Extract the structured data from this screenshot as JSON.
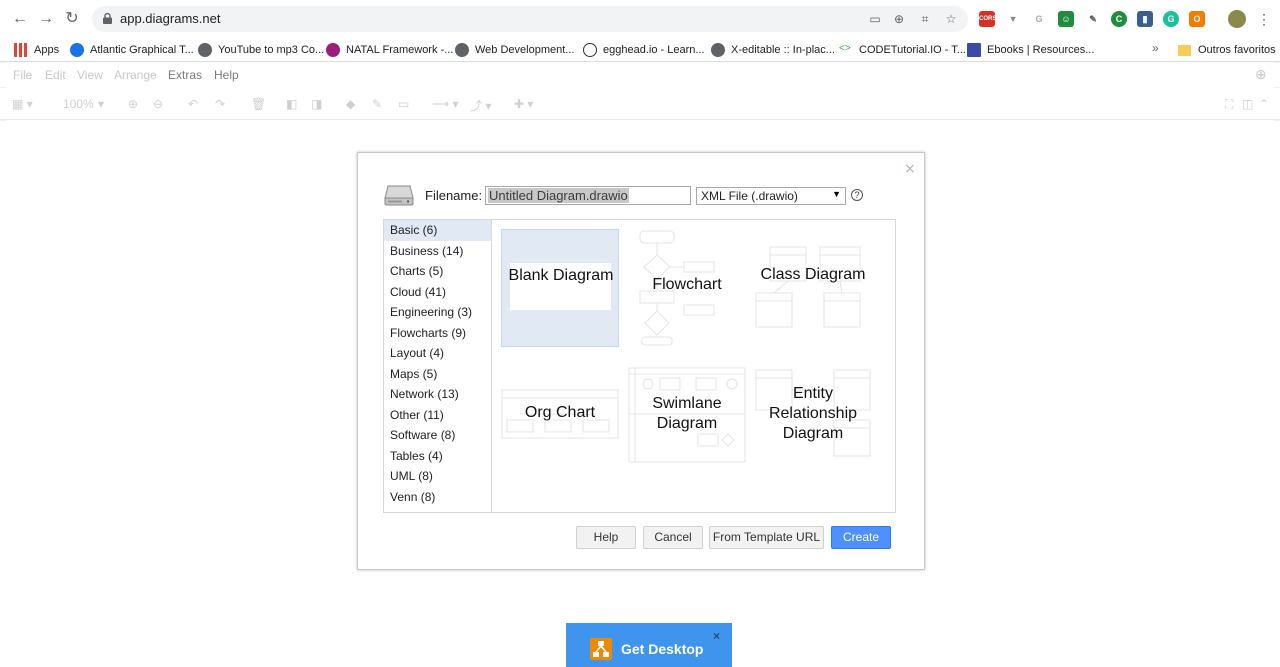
{
  "browser": {
    "url": "app.diagrams.net",
    "bookmarks": [
      {
        "label": "Apps",
        "color": "#e94235"
      },
      {
        "label": "Atlantic Graphical T...",
        "color": "#1a73e8"
      },
      {
        "label": "YouTube to mp3 Co...",
        "color": "#5f6368"
      },
      {
        "label": "NATAL Framework -...",
        "color": "#9c1d7a"
      },
      {
        "label": "Web Development...",
        "color": "#5f6368"
      },
      {
        "label": "egghead.io - Learn...",
        "color": "#333333"
      },
      {
        "label": "X-editable :: In-plac...",
        "color": "#5f6368"
      },
      {
        "label": "CODETutorial.IO - T...",
        "color": "#34a853"
      },
      {
        "label": "Ebooks | Resources...",
        "color": "#3a4aa8"
      }
    ],
    "more_label": "»",
    "other_bookmarks": "Outros favoritos"
  },
  "app": {
    "menus": [
      "File",
      "Edit",
      "View",
      "Arrange",
      "Extras",
      "Help"
    ],
    "zoom": "100%"
  },
  "dialog": {
    "close": "×",
    "filename_label": "Filename:",
    "filename_value": "Untitled Diagram.drawio",
    "format_value": "XML File (.drawio)",
    "help_icon_text": "?",
    "categories": [
      "Basic (6)",
      "Business (14)",
      "Charts (5)",
      "Cloud (41)",
      "Engineering (3)",
      "Flowcharts (9)",
      "Layout (4)",
      "Maps (5)",
      "Network (13)",
      "Other (11)",
      "Software (8)",
      "Tables (4)",
      "UML (8)",
      "Venn (8)"
    ],
    "templates": {
      "blank": "Blank Diagram",
      "flowchart": "Flowchart",
      "class": "Class Diagram",
      "org": "Org Chart",
      "swimlane": "Swimlane Diagram",
      "er": "Entity Relationship Diagram"
    },
    "buttons": {
      "help": "Help",
      "cancel": "Cancel",
      "from_url": "From Template URL",
      "create": "Create"
    }
  },
  "get_desktop": {
    "label": "Get Desktop",
    "close": "×"
  }
}
